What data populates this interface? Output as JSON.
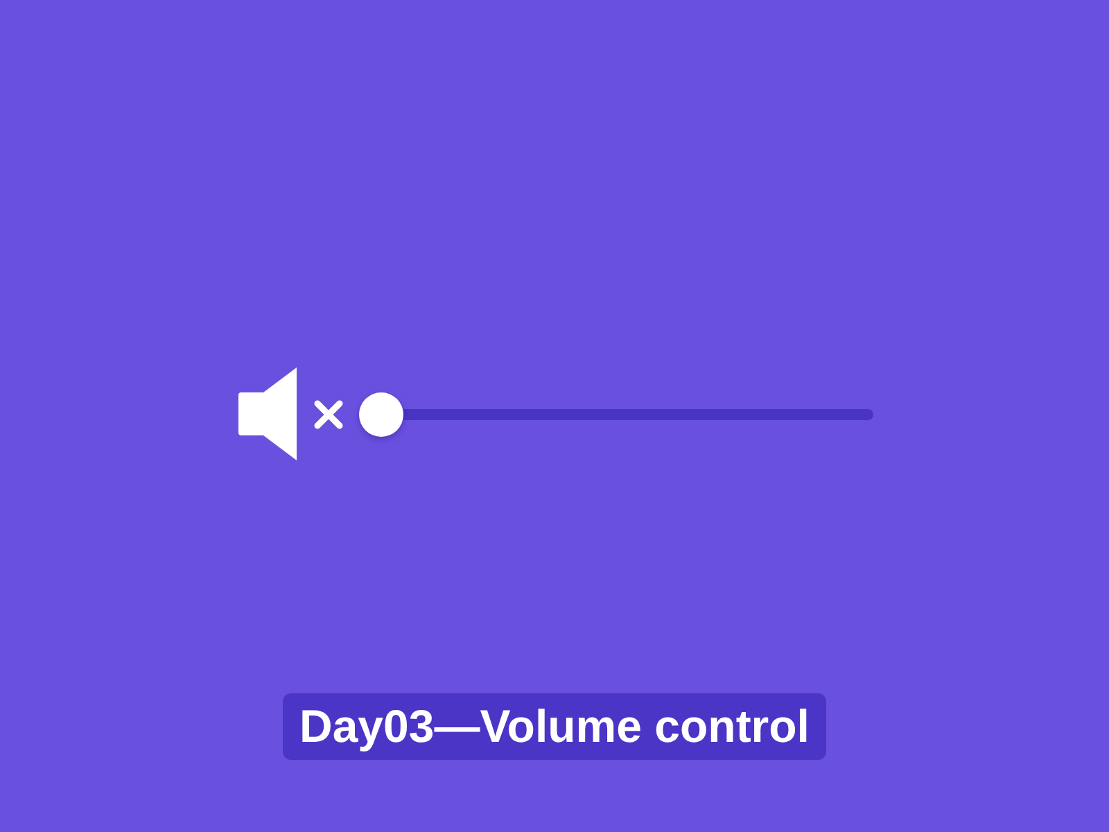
{
  "volume": {
    "muted": true,
    "level": 0
  },
  "caption": "Day03—Volume control"
}
